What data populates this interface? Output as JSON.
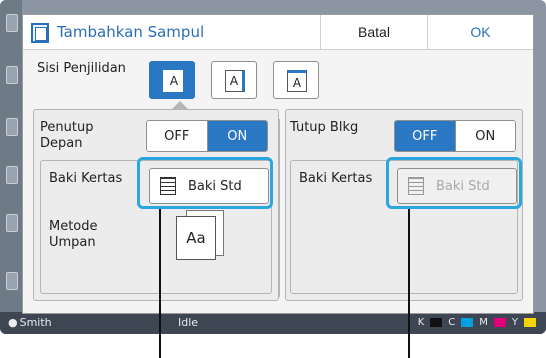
{
  "background": {
    "status_user": "Smith",
    "status_state": "Idle",
    "ink_labels": [
      "K",
      "C",
      "M",
      "Y"
    ],
    "ink_colors": [
      "#111111",
      "#00a0e0",
      "#e0007a",
      "#f2d400"
    ]
  },
  "dialog": {
    "title": "Tambahkan Sampul",
    "cancel_label": "Batal",
    "ok_label": "OK"
  },
  "binding": {
    "label": "Sisi Penjilidan",
    "options": [
      {
        "glyph": "A",
        "edge": "left",
        "selected": true
      },
      {
        "glyph": "A",
        "edge": "right",
        "selected": false
      },
      {
        "glyph": "A",
        "edge": "top",
        "selected": false
      }
    ]
  },
  "front_cover": {
    "label": "Penutup Depan",
    "off_label": "OFF",
    "on_label": "ON",
    "value": "ON",
    "tray_label": "Baki Kertas",
    "tray_value": "Baki Std",
    "feed_label": "Metode Umpan",
    "feed_glyph": "Aa"
  },
  "back_cover": {
    "label": "Tutup Blkg",
    "off_label": "OFF",
    "on_label": "ON",
    "value": "OFF",
    "tray_label": "Baki Kertas",
    "tray_value": "Baki Std"
  },
  "colors": {
    "accent": "#2a78c4",
    "callout": "#2ba7e0"
  }
}
